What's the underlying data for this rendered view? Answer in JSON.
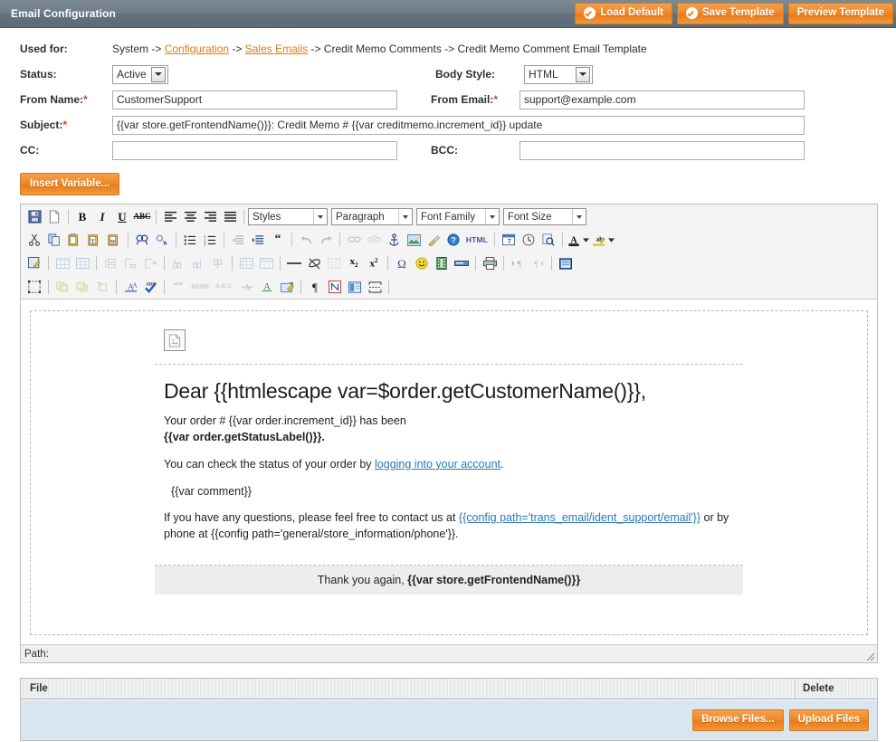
{
  "header": {
    "title": "Email Configuration",
    "buttons": [
      {
        "label": "Load Default",
        "icon": "check-circle-icon"
      },
      {
        "label": "Save Template",
        "icon": "check-circle-icon"
      },
      {
        "label": "Preview Template",
        "icon": "none"
      }
    ]
  },
  "form": {
    "used_for_label": "Used for:",
    "breadcrumb": {
      "part1": "System -> ",
      "link1": "Configuration",
      "part2": " -> ",
      "link2": "Sales Emails",
      "part3": " -> Credit Memo Comments -> Credit Memo Comment Email Template"
    },
    "status_label": "Status:",
    "status_value": "Active",
    "body_style_label": "Body Style:",
    "body_style_value": "HTML",
    "from_name_label": "From Name:",
    "from_name_value": "CustomerSupport",
    "from_email_label": "From Email:",
    "from_email_value": "support@example.com",
    "subject_label": "Subject:",
    "subject_value": "{{var store.getFrontendName()}}: Credit Memo # {{var creditmemo.increment_id}} update",
    "cc_label": "CC:",
    "cc_value": "",
    "bcc_label": "BCC:",
    "bcc_value": "",
    "required_marker": "*",
    "insert_variable_label": "Insert Variable..."
  },
  "editor": {
    "selects": {
      "styles": "Styles",
      "paragraph": "Paragraph",
      "font_family": "Font Family",
      "font_size": "Font Size"
    },
    "toolbar_row1": [
      "save-icon",
      "new-document-icon",
      "sep",
      "bold-icon",
      "italic-icon",
      "underline-icon",
      "strikethrough-icon",
      "sep",
      "align-left-icon",
      "align-center-icon",
      "align-right-icon",
      "align-justify-icon",
      "sep"
    ],
    "toolbar_row2": [
      "cut-icon",
      "copy-icon",
      "paste-icon",
      "paste-text-icon",
      "paste-word-icon",
      "sep",
      "find-icon",
      "find-replace-icon",
      "sep",
      "bullet-list-icon",
      "numbered-list-icon",
      "sep",
      "outdent-icon",
      "indent-icon",
      "blockquote-icon",
      "sep",
      "undo-icon",
      "redo-icon",
      "sep",
      "link-icon",
      "unlink-icon",
      "anchor-icon",
      "insert-image-icon",
      "cleanup-icon",
      "help-icon",
      "html-source-icon",
      "sep",
      "insert-date-icon",
      "insert-time-icon",
      "preview-icon",
      "sep",
      "text-color-icon",
      "background-color-icon"
    ],
    "toolbar_row3": [
      "edit-css-icon",
      "sep",
      "insert-table-icon",
      "table-properties-icon",
      "sep",
      "row-properties-icon",
      "insert-row-before-icon",
      "insert-row-after-icon",
      "sep",
      "delete-row-icon",
      "insert-column-before-icon",
      "insert-column-after-icon",
      "sep",
      "delete-column-icon",
      "split-cell-icon",
      "merge-cell-icon",
      "sep",
      "horizontal-rule-icon",
      "remove-format-icon",
      "visual-aid-icon",
      "sep",
      "subscript-icon",
      "superscript-icon",
      "sep",
      "special-char-icon",
      "emoticon-icon",
      "media-icon",
      "page-break-icon",
      "sep",
      "print-icon",
      "sep",
      "ltr-icon",
      "rtl-icon",
      "sep",
      "fullscreen-icon"
    ],
    "toolbar_row4": [
      "select-all-icon",
      "sep",
      "move-forward-icon",
      "move-backward-icon",
      "absolute-position-icon",
      "sep",
      "style-props-icon",
      "spellcheck-icon",
      "sep",
      "citation-icon",
      "abbreviation-icon",
      "acronym-icon",
      "delete-text-icon",
      "insert-text-icon",
      "attributes-icon",
      "sep",
      "show-invisible-icon",
      "nonbreaking-icon",
      "layer-icon",
      "page-break-line-icon",
      "sep"
    ],
    "path_label": "Path:"
  },
  "email": {
    "image_placeholder": "broken-image-icon",
    "greeting": "Dear {{htmlescape var=$order.getCustomerName()}},",
    "line1_plain": "Your order # {{var order.increment_id}} has been ",
    "line1_bold": "{{var order.getStatusLabel()}}.",
    "line2_pre": "You can check the status of your order by ",
    "line2_link": "logging into your account",
    "line2_post": ".",
    "line3": "{{var comment}}",
    "line4_pre": "If you have any questions, please feel free to contact us at ",
    "line4_link": "{{config path='trans_email/ident_support/email'}}",
    "line4_post": " or by phone at {{config path='general/store_information/phone'}}.",
    "footer_pre": "Thank you again, ",
    "footer_bold": "{{var store.getFrontendName()}}"
  },
  "files": {
    "col_file": "File",
    "col_delete": "Delete",
    "browse_label": "Browse Files...",
    "upload_label": "Upload Files"
  },
  "colors": {
    "accent_orange": "#ee8a2b",
    "header_gray": "#6d7c87",
    "link_orange": "#e07b10",
    "email_link_blue": "#2b77b5",
    "grid_row_blue": "#d9e5ef",
    "required_red": "#d4470c"
  }
}
